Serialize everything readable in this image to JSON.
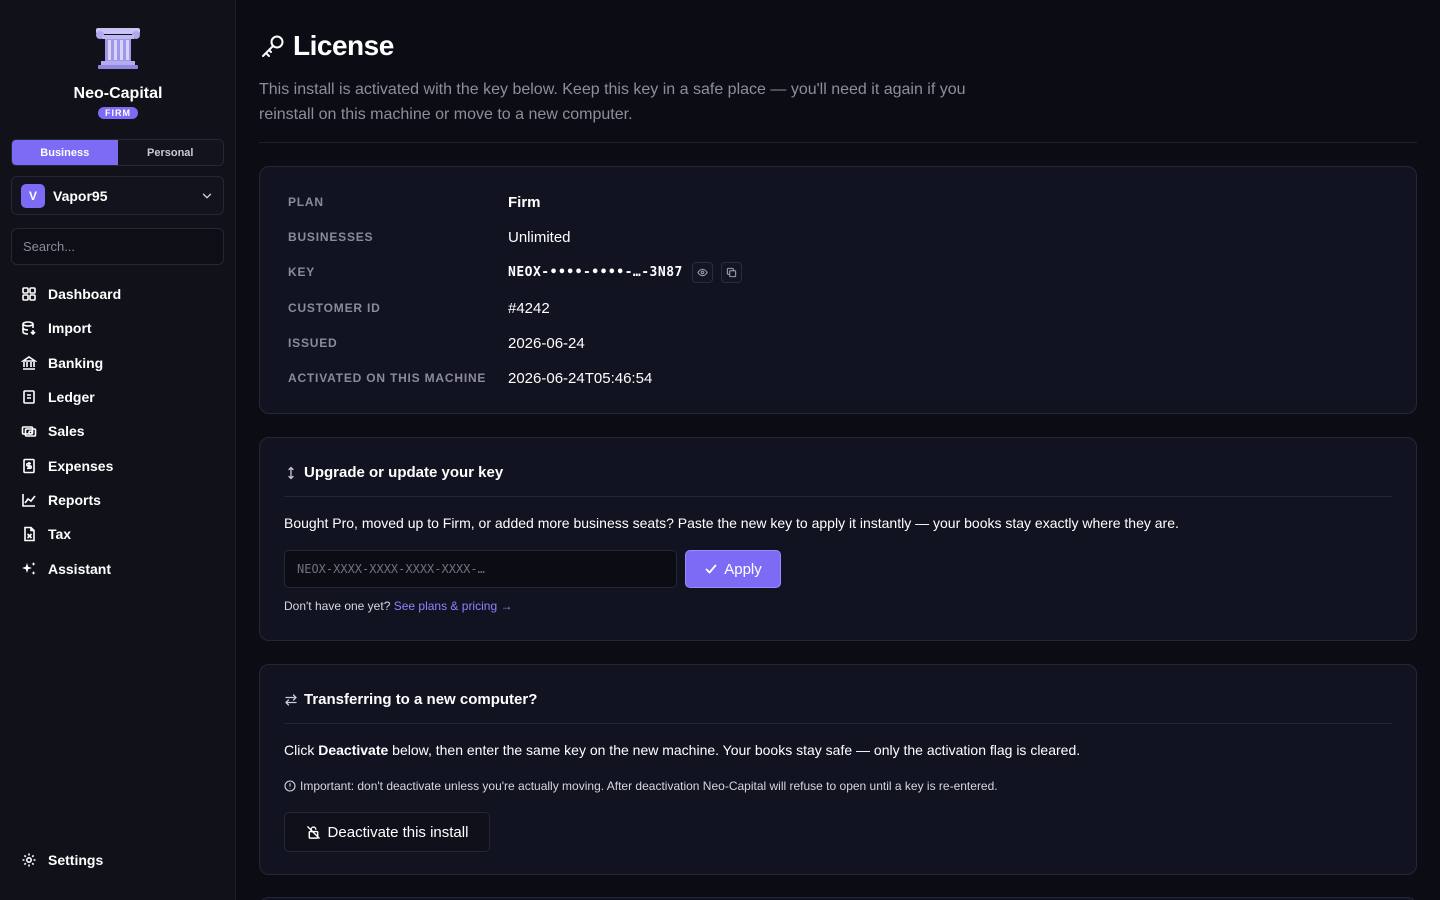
{
  "sidebar": {
    "brand": "Neo-Capital",
    "badge": "FIRM",
    "tabs": [
      {
        "label": "Business",
        "active": true
      },
      {
        "label": "Personal",
        "active": false
      }
    ],
    "account": {
      "initial": "V",
      "name": "Vapor95"
    },
    "search_placeholder": "Search...",
    "nav": [
      {
        "label": "Dashboard",
        "icon": "dashboard-icon"
      },
      {
        "label": "Import",
        "icon": "import-icon"
      },
      {
        "label": "Banking",
        "icon": "bank-icon"
      },
      {
        "label": "Ledger",
        "icon": "ledger-icon"
      },
      {
        "label": "Sales",
        "icon": "sales-icon"
      },
      {
        "label": "Expenses",
        "icon": "receipt-icon"
      },
      {
        "label": "Reports",
        "icon": "chart-icon"
      },
      {
        "label": "Tax",
        "icon": "tax-icon"
      },
      {
        "label": "Assistant",
        "icon": "sparkles-icon"
      }
    ],
    "settings": "Settings"
  },
  "page": {
    "title": "License",
    "intro": "This install is activated with the key below. Keep this key in a safe place — you'll need it again if you reinstall on this machine or move to a new computer."
  },
  "license": {
    "plan_label": "PLAN",
    "plan": "Firm",
    "businesses_label": "BUSINESSES",
    "businesses": "Unlimited",
    "key_label": "KEY",
    "key": "NEOX-••••-••••-…-3N87",
    "customer_label": "CUSTOMER ID",
    "customer_id": "#4242",
    "issued_label": "ISSUED",
    "issued": "2026-06-24",
    "activated_label": "ACTIVATED ON THIS MACHINE",
    "activated": "2026-06-24T05:46:54"
  },
  "upgrade": {
    "title": "Upgrade or update your key",
    "description": "Bought Pro, moved up to Firm, or added more business seats? Paste the new key to apply it instantly — your books stay exactly where they are.",
    "input_placeholder": "NEOX-XXXX-XXXX-XXXX-XXXX-…",
    "apply_label": "Apply",
    "no_key_text": "Don't have one yet?",
    "pricing_link": "See plans & pricing →"
  },
  "transfer": {
    "title": "Transferring to a new computer?",
    "text_prefix": "Click ",
    "text_bold": "Deactivate",
    "text_suffix": " below, then enter the same key on the new machine. Your books stay safe — only the activation flag is cleared.",
    "warning": "Important: don't deactivate unless you're actually moving. After deactivation Neo-Capital will refuse to open until a key is re-entered.",
    "button_label": "Deactivate this install"
  },
  "colors": {
    "accent": "#7c6cf5",
    "background": "#0b0c14",
    "sidebar": "#101119",
    "card": "#121320"
  }
}
